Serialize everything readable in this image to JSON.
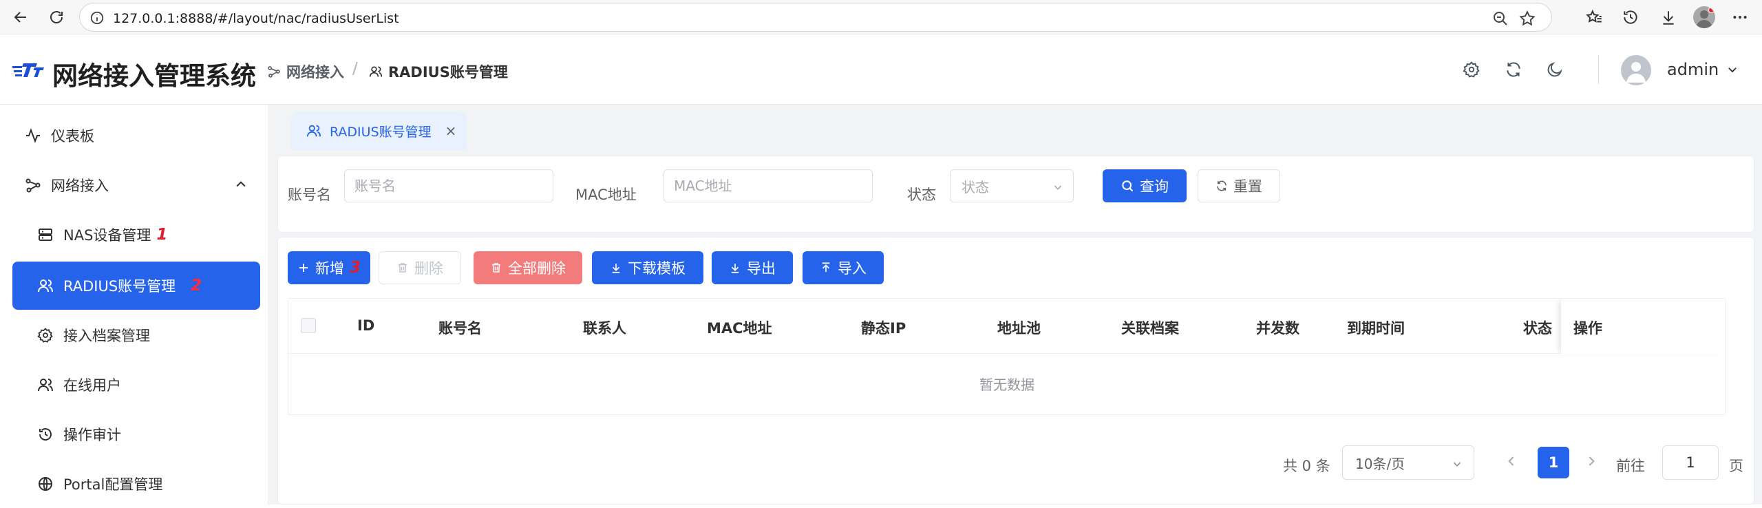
{
  "browser": {
    "url": "127.0.0.1:8888/#/layout/nac/radiusUserList"
  },
  "header": {
    "app_title": "网络接入管理系统",
    "breadcrumb": [
      "网络接入",
      "RADIUS账号管理"
    ],
    "breadcrumb_sep": "/",
    "username": "admin"
  },
  "sidebar": {
    "items": [
      {
        "label": "仪表板",
        "icon": "activity-icon",
        "mark": ""
      },
      {
        "label": "网络接入",
        "icon": "network-icon",
        "mark": ""
      },
      {
        "label": "NAS设备管理",
        "icon": "server-icon",
        "mark": "1"
      },
      {
        "label": "RADIUS账号管理",
        "icon": "users-icon",
        "mark": "2"
      },
      {
        "label": "接入档案管理",
        "icon": "gear-icon",
        "mark": ""
      },
      {
        "label": "在线用户",
        "icon": "users-icon",
        "mark": ""
      },
      {
        "label": "操作审计",
        "icon": "history-icon",
        "mark": ""
      },
      {
        "label": "Portal配置管理",
        "icon": "globe-icon",
        "mark": ""
      }
    ]
  },
  "tabs": [
    {
      "label": "RADIUS账号管理",
      "close": "×"
    }
  ],
  "search": {
    "account_label": "账号名",
    "account_placeholder": "账号名",
    "mac_label": "MAC地址",
    "mac_placeholder": "MAC地址",
    "status_label": "状态",
    "status_placeholder": "状态",
    "query_label": "查询",
    "reset_label": "重置"
  },
  "toolbar": {
    "add_label": "新增",
    "add_mark": "3",
    "delete_label": "删除",
    "delete_all_label": "全部删除",
    "download_template_label": "下载模板",
    "export_label": "导出",
    "import_label": "导入"
  },
  "table": {
    "columns": [
      "ID",
      "账号名",
      "联系人",
      "MAC地址",
      "静态IP",
      "地址池",
      "关联档案",
      "并发数",
      "到期时间",
      "状态"
    ],
    "operation_column": "操作",
    "empty_text": "暂无数据"
  },
  "pagination": {
    "total": "共 0 条",
    "page_size": "10条/页",
    "current_page": "1",
    "goto_label": "前往",
    "goto_value": "1",
    "page_suffix": "页"
  },
  "colors": {
    "primary": "#2563eb",
    "danger_light": "#f37b7b",
    "mark_red": "#e11d2e"
  }
}
